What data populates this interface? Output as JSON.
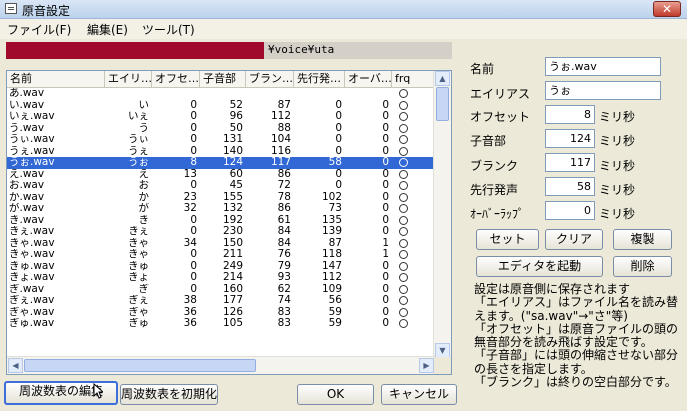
{
  "window": {
    "title": "原音設定",
    "close_label": "✕"
  },
  "menu": [
    "ファイル(F)",
    "編集(E)",
    "ツール(T)"
  ],
  "path": {
    "text": "¥voice¥uta",
    "mask_color": "#a00a2c"
  },
  "list": {
    "columns": [
      "名前",
      "エイリ…",
      "オフセ…",
      "子音部",
      "ブラン…",
      "先行発…",
      "オーバ…",
      "frq"
    ],
    "rows": [
      {
        "name": "あ.wav",
        "alias": "",
        "offset": "",
        "consonant": "",
        "blank": "",
        "preutter": "",
        "overlap": "",
        "frq": true
      },
      {
        "name": "い.wav",
        "alias": "い",
        "offset": "0",
        "consonant": "52",
        "blank": "87",
        "preutter": "0",
        "overlap": "0",
        "frq": true
      },
      {
        "name": "いぇ.wav",
        "alias": "いぇ",
        "offset": "0",
        "consonant": "96",
        "blank": "112",
        "preutter": "0",
        "overlap": "0",
        "frq": true
      },
      {
        "name": "う.wav",
        "alias": "う",
        "offset": "0",
        "consonant": "50",
        "blank": "88",
        "preutter": "0",
        "overlap": "0",
        "frq": true
      },
      {
        "name": "うぃ.wav",
        "alias": "うぃ",
        "offset": "0",
        "consonant": "131",
        "blank": "104",
        "preutter": "0",
        "overlap": "0",
        "frq": true
      },
      {
        "name": "うぇ.wav",
        "alias": "うぇ",
        "offset": "0",
        "consonant": "140",
        "blank": "116",
        "preutter": "0",
        "overlap": "0",
        "frq": true
      },
      {
        "name": "うぉ.wav",
        "alias": "うぉ",
        "offset": "8",
        "consonant": "124",
        "blank": "117",
        "preutter": "58",
        "overlap": "0",
        "frq": true
      },
      {
        "name": "え.wav",
        "alias": "え",
        "offset": "13",
        "consonant": "60",
        "blank": "86",
        "preutter": "0",
        "overlap": "0",
        "frq": true
      },
      {
        "name": "お.wav",
        "alias": "お",
        "offset": "0",
        "consonant": "45",
        "blank": "72",
        "preutter": "0",
        "overlap": "0",
        "frq": true
      },
      {
        "name": "か.wav",
        "alias": "か",
        "offset": "23",
        "consonant": "155",
        "blank": "78",
        "preutter": "102",
        "overlap": "0",
        "frq": true
      },
      {
        "name": "が.wav",
        "alias": "が",
        "offset": "32",
        "consonant": "132",
        "blank": "86",
        "preutter": "73",
        "overlap": "0",
        "frq": true
      },
      {
        "name": "き.wav",
        "alias": "き",
        "offset": "0",
        "consonant": "192",
        "blank": "61",
        "preutter": "135",
        "overlap": "0",
        "frq": true
      },
      {
        "name": "きぇ.wav",
        "alias": "きぇ",
        "offset": "0",
        "consonant": "230",
        "blank": "84",
        "preutter": "139",
        "overlap": "0",
        "frq": true
      },
      {
        "name": "きゃ.wav",
        "alias": "きゃ",
        "offset": "34",
        "consonant": "150",
        "blank": "84",
        "preutter": "87",
        "overlap": "1",
        "frq": true
      },
      {
        "name": "きゃ.wav",
        "alias": "きゃ",
        "offset": "0",
        "consonant": "211",
        "blank": "76",
        "preutter": "118",
        "overlap": "1",
        "frq": true
      },
      {
        "name": "きゅ.wav",
        "alias": "きゅ",
        "offset": "0",
        "consonant": "249",
        "blank": "79",
        "preutter": "147",
        "overlap": "0",
        "frq": true
      },
      {
        "name": "きょ.wav",
        "alias": "きょ",
        "offset": "0",
        "consonant": "214",
        "blank": "93",
        "preutter": "112",
        "overlap": "0",
        "frq": true
      },
      {
        "name": "ぎ.wav",
        "alias": "ぎ",
        "offset": "0",
        "consonant": "160",
        "blank": "62",
        "preutter": "109",
        "overlap": "0",
        "frq": true
      },
      {
        "name": "ぎぇ.wav",
        "alias": "ぎぇ",
        "offset": "38",
        "consonant": "177",
        "blank": "74",
        "preutter": "56",
        "overlap": "0",
        "frq": true
      },
      {
        "name": "ぎゃ.wav",
        "alias": "ぎゃ",
        "offset": "36",
        "consonant": "126",
        "blank": "83",
        "preutter": "59",
        "overlap": "0",
        "frq": true
      },
      {
        "name": "ぎゅ.wav",
        "alias": "ぎゅ",
        "offset": "36",
        "consonant": "105",
        "blank": "83",
        "preutter": "59",
        "overlap": "0",
        "frq": true
      }
    ],
    "selected_index": 6
  },
  "panel": {
    "name_label": "名前",
    "name_value": "うぉ.wav",
    "alias_label": "エイリアス",
    "alias_value": "うぉ",
    "offset_label": "オフセット",
    "offset_value": "8",
    "offset_unit": "ミリ秒",
    "consonant_label": "子音部",
    "consonant_value": "124",
    "consonant_unit": "ミリ秒",
    "blank_label": "ブランク",
    "blank_value": "117",
    "blank_unit": "ミリ秒",
    "preutter_label": "先行発声",
    "preutter_value": "58",
    "preutter_unit": "ミリ秒",
    "overlap_label": "ｵｰﾊﾞｰﾗｯﾌﾟ",
    "overlap_value": "0",
    "overlap_unit": "ミリ秒"
  },
  "buttons": {
    "set": "セット",
    "clear": "クリア",
    "copy": "複製",
    "editor": "エディタを起動",
    "delete": "削除",
    "edit_freq": "周波数表の編集",
    "init_freq": "周波数表を初期化",
    "ok": "OK",
    "cancel": "キャンセル"
  },
  "info": [
    "設定は原音側に保存されます",
    "「エイリアス」はファイル名を読み替えます。(\"sa.wav\"→\"さ\"等)",
    "「オフセット」は原音ファイルの頭の無音部分を読み飛ばす設定です。",
    "「子音部」には頭の伸縮させない部分の長さを指定します。",
    "「ブランク」は終りの空白部分です。"
  ]
}
